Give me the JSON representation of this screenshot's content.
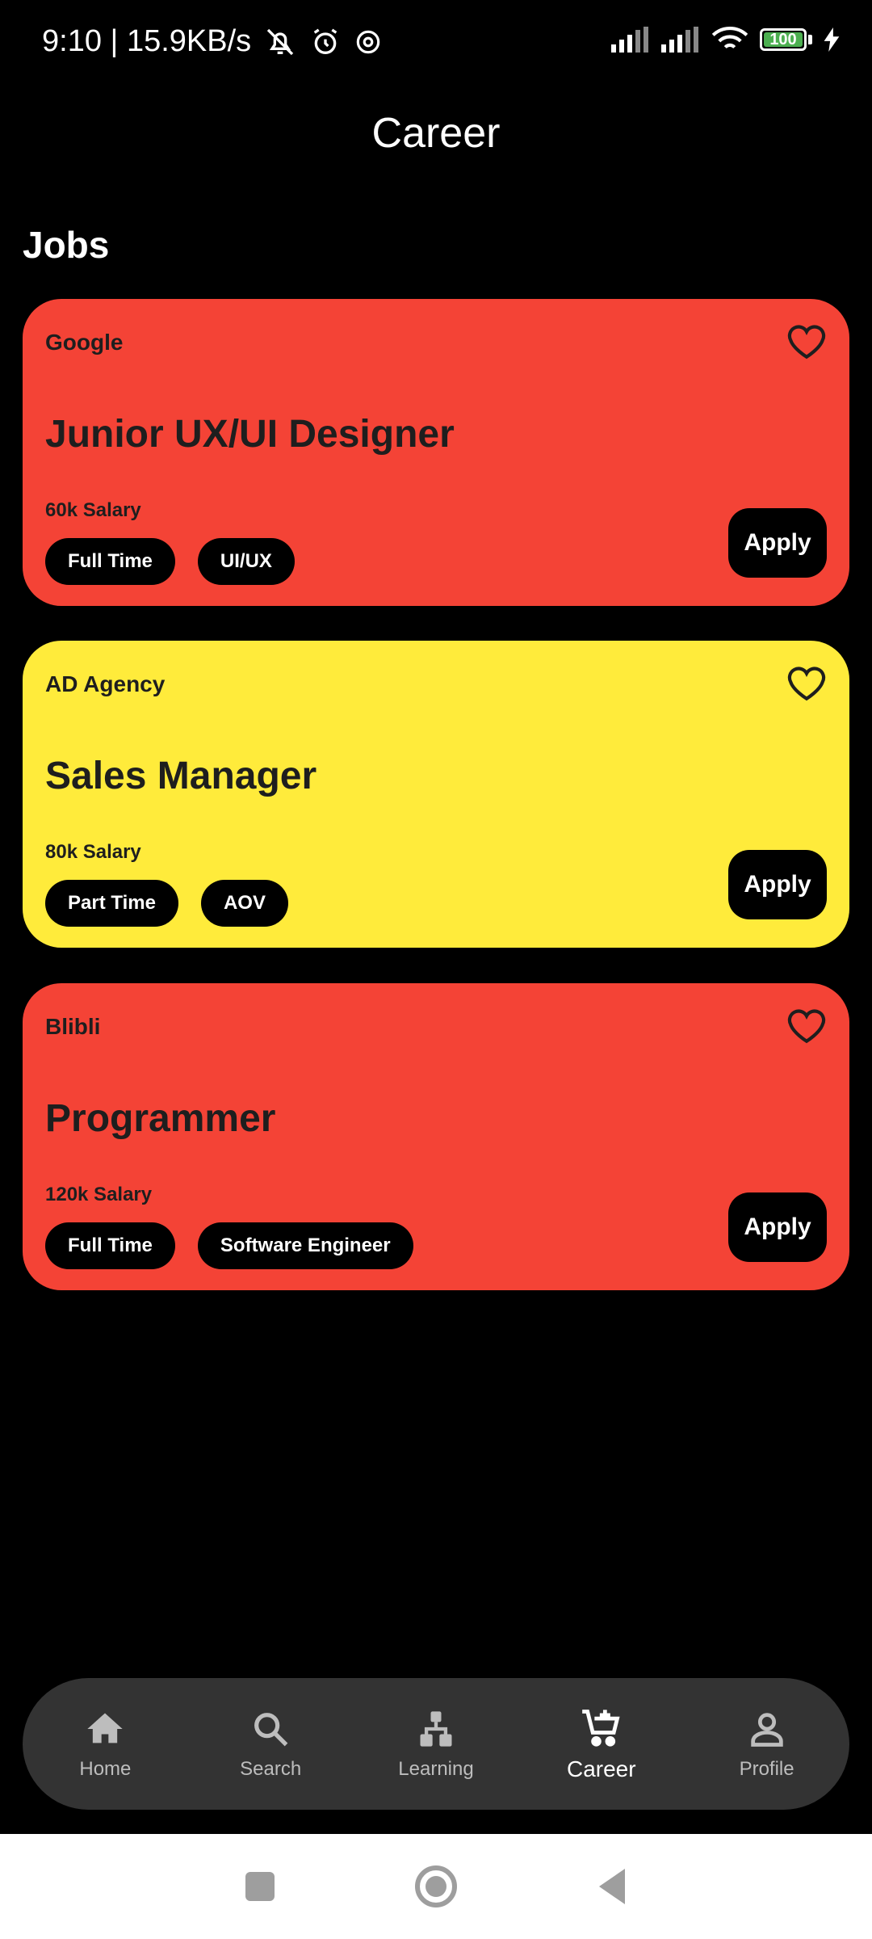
{
  "status_bar": {
    "time": "9:10 | 15.9KB/s",
    "battery": "100"
  },
  "header": {
    "title": "Career"
  },
  "section": {
    "title": "Jobs"
  },
  "jobs": [
    {
      "company": "Google",
      "title": "Junior UX/UI Designer",
      "salary": "60k Salary",
      "tags": [
        "Full Time",
        "UI/UX"
      ],
      "apply_label": "Apply",
      "color": "#f44336"
    },
    {
      "company": "AD Agency",
      "title": "Sales Manager",
      "salary": "80k Salary",
      "tags": [
        "Part Time",
        "AOV"
      ],
      "apply_label": "Apply",
      "color": "#ffeb3b"
    },
    {
      "company": "Blibli",
      "title": "Programmer",
      "salary": "120k Salary",
      "tags": [
        "Full Time",
        "Software Engineer"
      ],
      "apply_label": "Apply",
      "color": "#f44336"
    }
  ],
  "bottom_nav": {
    "items": [
      {
        "label": "Home",
        "icon": "home-icon"
      },
      {
        "label": "Search",
        "icon": "search-icon"
      },
      {
        "label": "Learning",
        "icon": "learning-icon"
      },
      {
        "label": "Career",
        "icon": "cart-add-icon",
        "active": true
      },
      {
        "label": "Profile",
        "icon": "profile-icon"
      }
    ]
  },
  "system_nav": {
    "icons": [
      "recents-icon",
      "home-circle-icon",
      "back-icon"
    ]
  }
}
